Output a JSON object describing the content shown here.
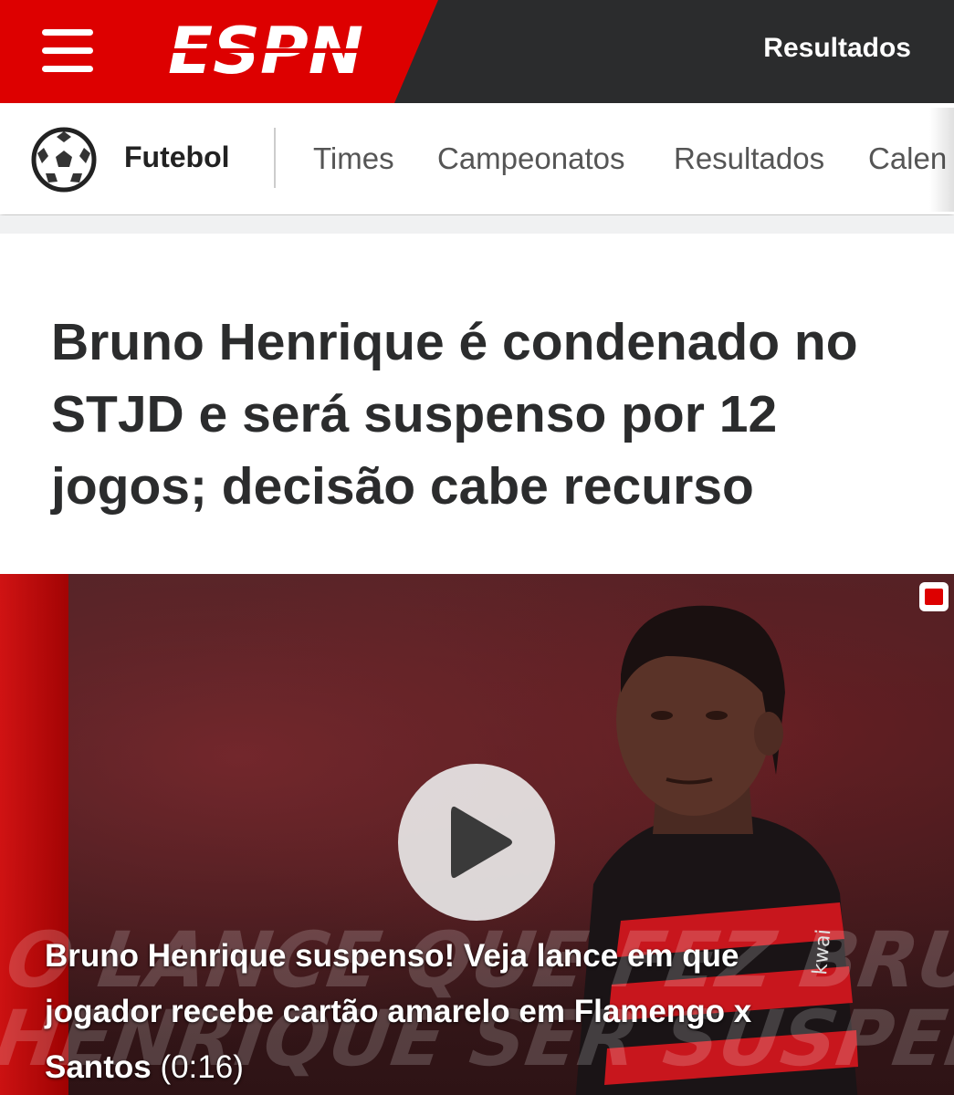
{
  "header": {
    "logo_text": "ESPN",
    "results_link": "Resultados"
  },
  "subnav": {
    "sport": "Futebol",
    "links": [
      "Times",
      "Campeonatos",
      "Resultados",
      "Calen"
    ]
  },
  "article": {
    "headline": "Bruno Henrique é condenado no STJD e será suspenso por 12 jogos; decisão cabe recurso"
  },
  "video": {
    "background_text_line1": "O LANCE QUE FEZ BRUNO",
    "background_text_line2": "HENRIQUE SER SUSPENSO",
    "caption": "Bruno Henrique suspenso! Veja lance em que jogador recebe cartão amarelo em Flamengo x Santos",
    "duration": "(0:16)"
  },
  "colors": {
    "brand_red": "#dd0000",
    "topbar_dark": "#2b2c2d"
  },
  "icons": [
    "menu-icon",
    "soccer-ball-icon",
    "play-icon",
    "espn-badge-icon"
  ]
}
